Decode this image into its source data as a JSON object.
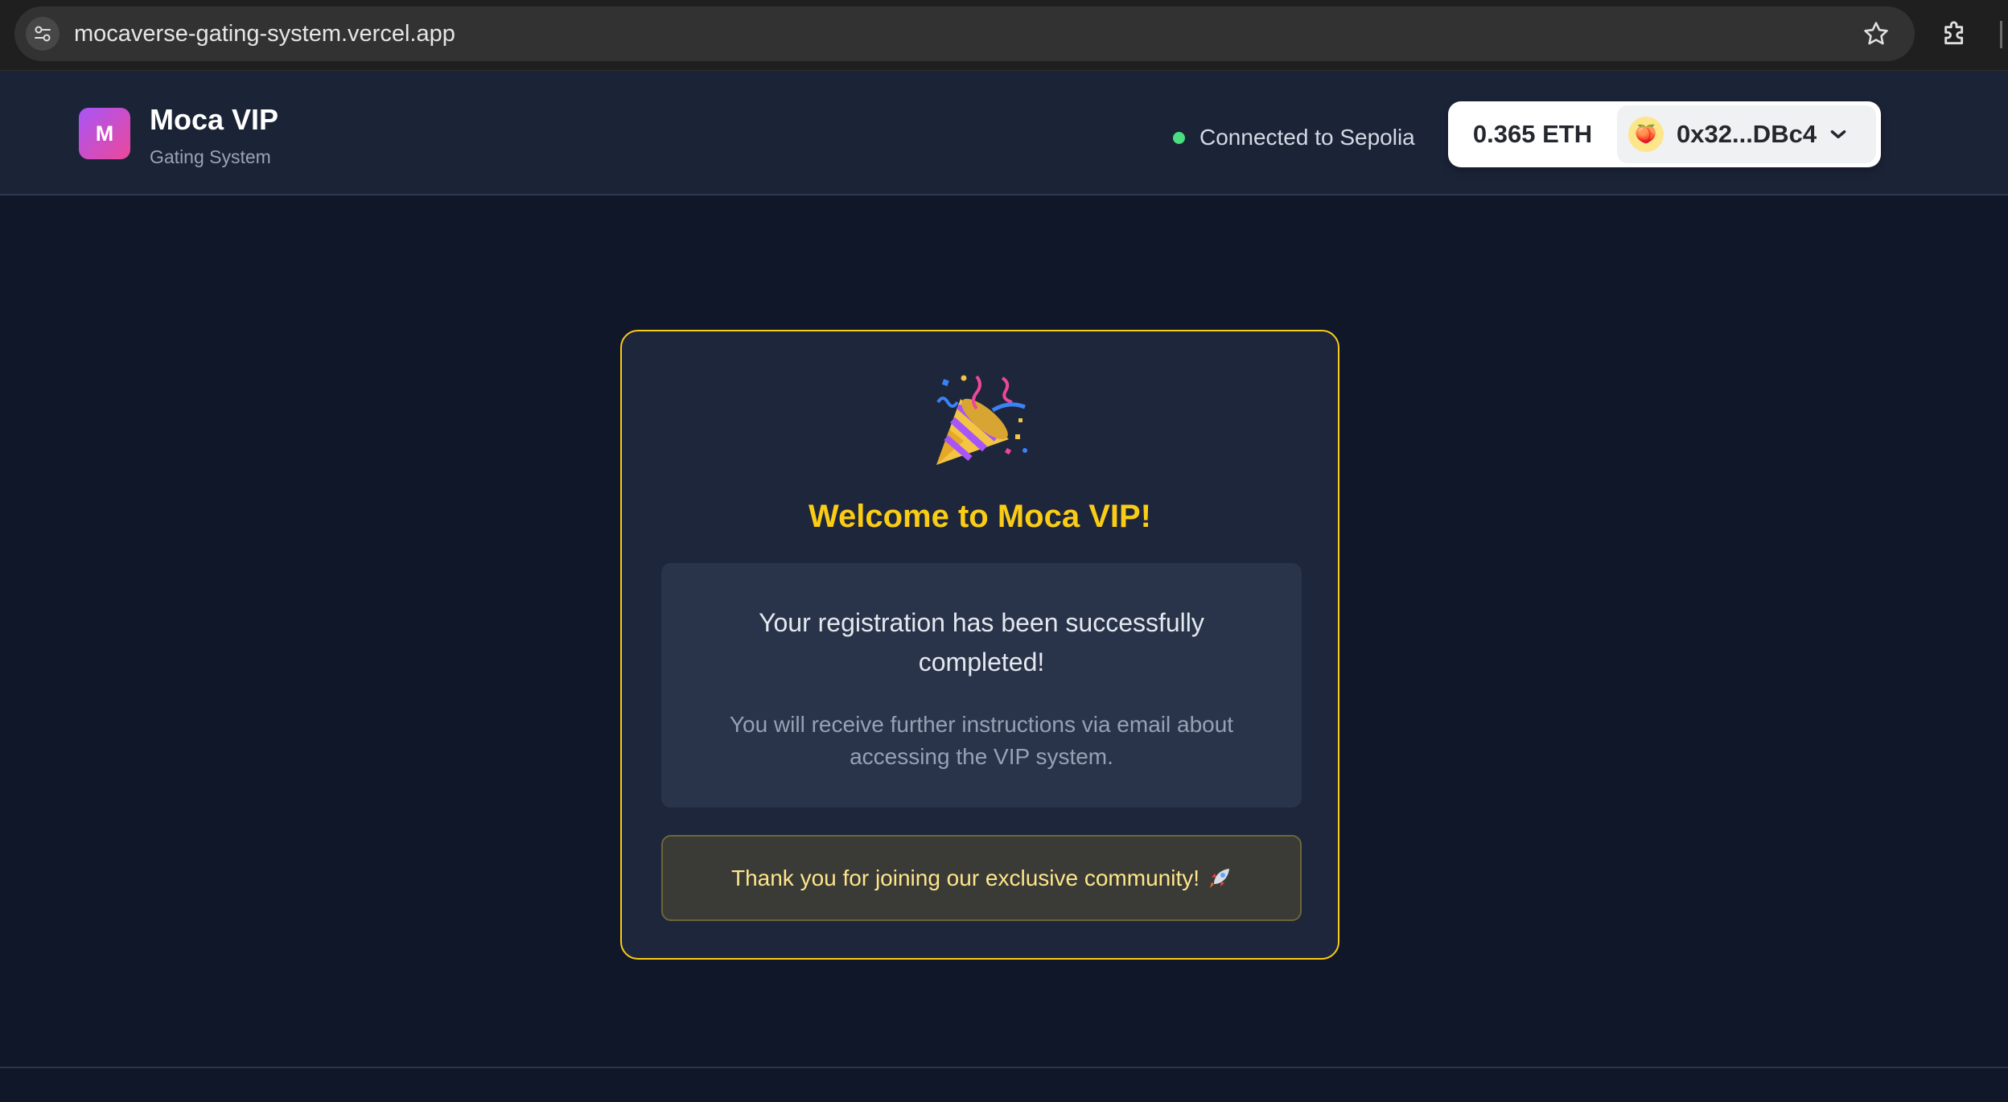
{
  "browser": {
    "url": "mocaverse-gating-system.vercel.app"
  },
  "header": {
    "logo_letter": "M",
    "title": "Moca VIP",
    "subtitle": "Gating System",
    "network_status": "Connected to Sepolia",
    "status_color": "#4ade80"
  },
  "wallet": {
    "balance": "0.365 ETH",
    "address": "0x32...DBc4",
    "avatar_emoji": "🍑"
  },
  "card": {
    "title": "Welcome to Moca VIP!",
    "message_primary": "Your registration has been successfully completed!",
    "message_secondary": "You will receive further instructions via email about accessing the VIP system.",
    "thanks": "Thank you for joining our exclusive community!",
    "accent_color": "#facc15"
  },
  "icons": {
    "party": "party-popper-icon",
    "rocket": "rocket-icon"
  }
}
